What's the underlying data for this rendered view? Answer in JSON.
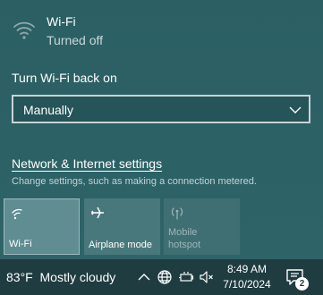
{
  "wifi_status": {
    "title": "Wi-Fi",
    "subtitle": "Turned off",
    "icon": "wifi-off-icon"
  },
  "turn_back_on": {
    "label": "Turn Wi-Fi back on",
    "selected": "Manually"
  },
  "network_settings": {
    "link": "Network & Internet settings",
    "description": "Change settings, such as making a connection metered."
  },
  "quick_actions": [
    {
      "label": "Wi-Fi",
      "icon": "wifi-icon",
      "state": "on"
    },
    {
      "label": "Airplane mode",
      "icon": "airplane-icon",
      "state": "off"
    },
    {
      "label": "Mobile\nhotspot",
      "icon": "mobile-hotspot-icon",
      "state": "disabled"
    }
  ],
  "taskbar": {
    "weather": "83°F  Mostly cloudy",
    "time": "8:49 AM",
    "date": "7/10/2024",
    "notification_count": "2"
  },
  "colors": {
    "flyout_bg": "#2b5f64",
    "taskbar_bg": "#1f3c41",
    "tile_active": "#5f8d91"
  }
}
